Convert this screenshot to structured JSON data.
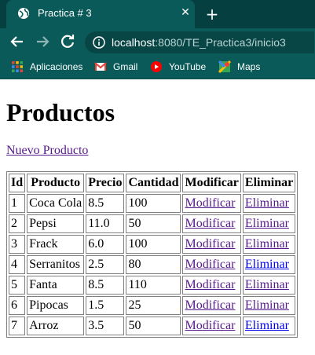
{
  "browser": {
    "tab_title": "Practica # 3",
    "url_host": "localhost",
    "url_rest": ":8080/TE_Practica3/inicio3",
    "bookmarks": [
      {
        "label": "Aplicaciones",
        "icon": "apps-grid-icon"
      },
      {
        "label": "Gmail",
        "icon": "gmail-icon"
      },
      {
        "label": "YouTube",
        "icon": "youtube-icon"
      },
      {
        "label": "Maps",
        "icon": "maps-icon"
      }
    ]
  },
  "page": {
    "title": "Productos",
    "new_link": "Nuevo Producto",
    "table": {
      "headers": [
        "Id",
        "Producto",
        "Precio",
        "Cantidad",
        "Modificar",
        "Eliminar"
      ],
      "rows": [
        {
          "id": "1",
          "producto": "Coca Cola",
          "precio": "8.5",
          "cantidad": "100",
          "modificar": "Modificar",
          "eliminar": "Eliminar"
        },
        {
          "id": "2",
          "producto": "Pepsi",
          "precio": "11.0",
          "cantidad": "50",
          "modificar": "Modificar",
          "eliminar": "Eliminar"
        },
        {
          "id": "3",
          "producto": "Frack",
          "precio": "6.0",
          "cantidad": "100",
          "modificar": "Modificar",
          "eliminar": "Eliminar"
        },
        {
          "id": "4",
          "producto": "Serranitos",
          "precio": "2.5",
          "cantidad": "80",
          "modificar": "Modificar",
          "eliminar": "Eliminar"
        },
        {
          "id": "5",
          "producto": "Fanta",
          "precio": "8.5",
          "cantidad": "110",
          "modificar": "Modificar",
          "eliminar": "Eliminar"
        },
        {
          "id": "6",
          "producto": "Pipocas",
          "precio": "1.5",
          "cantidad": "25",
          "modificar": "Modificar",
          "eliminar": "Eliminar"
        },
        {
          "id": "7",
          "producto": "Arroz",
          "precio": "3.5",
          "cantidad": "50",
          "modificar": "Modificar",
          "eliminar": "Eliminar"
        }
      ]
    }
  },
  "colors": {
    "chrome": "#0b5a5a",
    "visited_link": "#551a8b",
    "unvisited_link": "#0000ee"
  }
}
